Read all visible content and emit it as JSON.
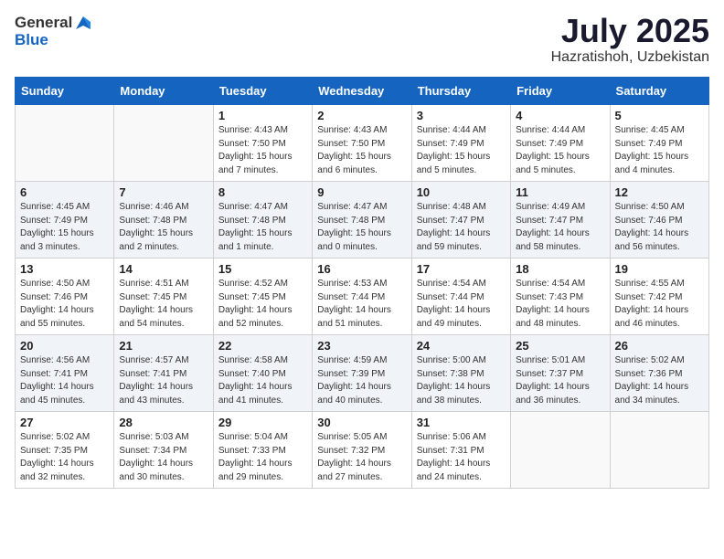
{
  "header": {
    "logo_general": "General",
    "logo_blue": "Blue",
    "title": "July 2025",
    "location": "Hazratishoh, Uzbekistan"
  },
  "days_of_week": [
    "Sunday",
    "Monday",
    "Tuesday",
    "Wednesday",
    "Thursday",
    "Friday",
    "Saturday"
  ],
  "weeks": [
    [
      {
        "day": "",
        "info": ""
      },
      {
        "day": "",
        "info": ""
      },
      {
        "day": "1",
        "info": "Sunrise: 4:43 AM\nSunset: 7:50 PM\nDaylight: 15 hours and 7 minutes."
      },
      {
        "day": "2",
        "info": "Sunrise: 4:43 AM\nSunset: 7:50 PM\nDaylight: 15 hours and 6 minutes."
      },
      {
        "day": "3",
        "info": "Sunrise: 4:44 AM\nSunset: 7:49 PM\nDaylight: 15 hours and 5 minutes."
      },
      {
        "day": "4",
        "info": "Sunrise: 4:44 AM\nSunset: 7:49 PM\nDaylight: 15 hours and 5 minutes."
      },
      {
        "day": "5",
        "info": "Sunrise: 4:45 AM\nSunset: 7:49 PM\nDaylight: 15 hours and 4 minutes."
      }
    ],
    [
      {
        "day": "6",
        "info": "Sunrise: 4:45 AM\nSunset: 7:49 PM\nDaylight: 15 hours and 3 minutes."
      },
      {
        "day": "7",
        "info": "Sunrise: 4:46 AM\nSunset: 7:48 PM\nDaylight: 15 hours and 2 minutes."
      },
      {
        "day": "8",
        "info": "Sunrise: 4:47 AM\nSunset: 7:48 PM\nDaylight: 15 hours and 1 minute."
      },
      {
        "day": "9",
        "info": "Sunrise: 4:47 AM\nSunset: 7:48 PM\nDaylight: 15 hours and 0 minutes."
      },
      {
        "day": "10",
        "info": "Sunrise: 4:48 AM\nSunset: 7:47 PM\nDaylight: 14 hours and 59 minutes."
      },
      {
        "day": "11",
        "info": "Sunrise: 4:49 AM\nSunset: 7:47 PM\nDaylight: 14 hours and 58 minutes."
      },
      {
        "day": "12",
        "info": "Sunrise: 4:50 AM\nSunset: 7:46 PM\nDaylight: 14 hours and 56 minutes."
      }
    ],
    [
      {
        "day": "13",
        "info": "Sunrise: 4:50 AM\nSunset: 7:46 PM\nDaylight: 14 hours and 55 minutes."
      },
      {
        "day": "14",
        "info": "Sunrise: 4:51 AM\nSunset: 7:45 PM\nDaylight: 14 hours and 54 minutes."
      },
      {
        "day": "15",
        "info": "Sunrise: 4:52 AM\nSunset: 7:45 PM\nDaylight: 14 hours and 52 minutes."
      },
      {
        "day": "16",
        "info": "Sunrise: 4:53 AM\nSunset: 7:44 PM\nDaylight: 14 hours and 51 minutes."
      },
      {
        "day": "17",
        "info": "Sunrise: 4:54 AM\nSunset: 7:44 PM\nDaylight: 14 hours and 49 minutes."
      },
      {
        "day": "18",
        "info": "Sunrise: 4:54 AM\nSunset: 7:43 PM\nDaylight: 14 hours and 48 minutes."
      },
      {
        "day": "19",
        "info": "Sunrise: 4:55 AM\nSunset: 7:42 PM\nDaylight: 14 hours and 46 minutes."
      }
    ],
    [
      {
        "day": "20",
        "info": "Sunrise: 4:56 AM\nSunset: 7:41 PM\nDaylight: 14 hours and 45 minutes."
      },
      {
        "day": "21",
        "info": "Sunrise: 4:57 AM\nSunset: 7:41 PM\nDaylight: 14 hours and 43 minutes."
      },
      {
        "day": "22",
        "info": "Sunrise: 4:58 AM\nSunset: 7:40 PM\nDaylight: 14 hours and 41 minutes."
      },
      {
        "day": "23",
        "info": "Sunrise: 4:59 AM\nSunset: 7:39 PM\nDaylight: 14 hours and 40 minutes."
      },
      {
        "day": "24",
        "info": "Sunrise: 5:00 AM\nSunset: 7:38 PM\nDaylight: 14 hours and 38 minutes."
      },
      {
        "day": "25",
        "info": "Sunrise: 5:01 AM\nSunset: 7:37 PM\nDaylight: 14 hours and 36 minutes."
      },
      {
        "day": "26",
        "info": "Sunrise: 5:02 AM\nSunset: 7:36 PM\nDaylight: 14 hours and 34 minutes."
      }
    ],
    [
      {
        "day": "27",
        "info": "Sunrise: 5:02 AM\nSunset: 7:35 PM\nDaylight: 14 hours and 32 minutes."
      },
      {
        "day": "28",
        "info": "Sunrise: 5:03 AM\nSunset: 7:34 PM\nDaylight: 14 hours and 30 minutes."
      },
      {
        "day": "29",
        "info": "Sunrise: 5:04 AM\nSunset: 7:33 PM\nDaylight: 14 hours and 29 minutes."
      },
      {
        "day": "30",
        "info": "Sunrise: 5:05 AM\nSunset: 7:32 PM\nDaylight: 14 hours and 27 minutes."
      },
      {
        "day": "31",
        "info": "Sunrise: 5:06 AM\nSunset: 7:31 PM\nDaylight: 14 hours and 24 minutes."
      },
      {
        "day": "",
        "info": ""
      },
      {
        "day": "",
        "info": ""
      }
    ]
  ]
}
